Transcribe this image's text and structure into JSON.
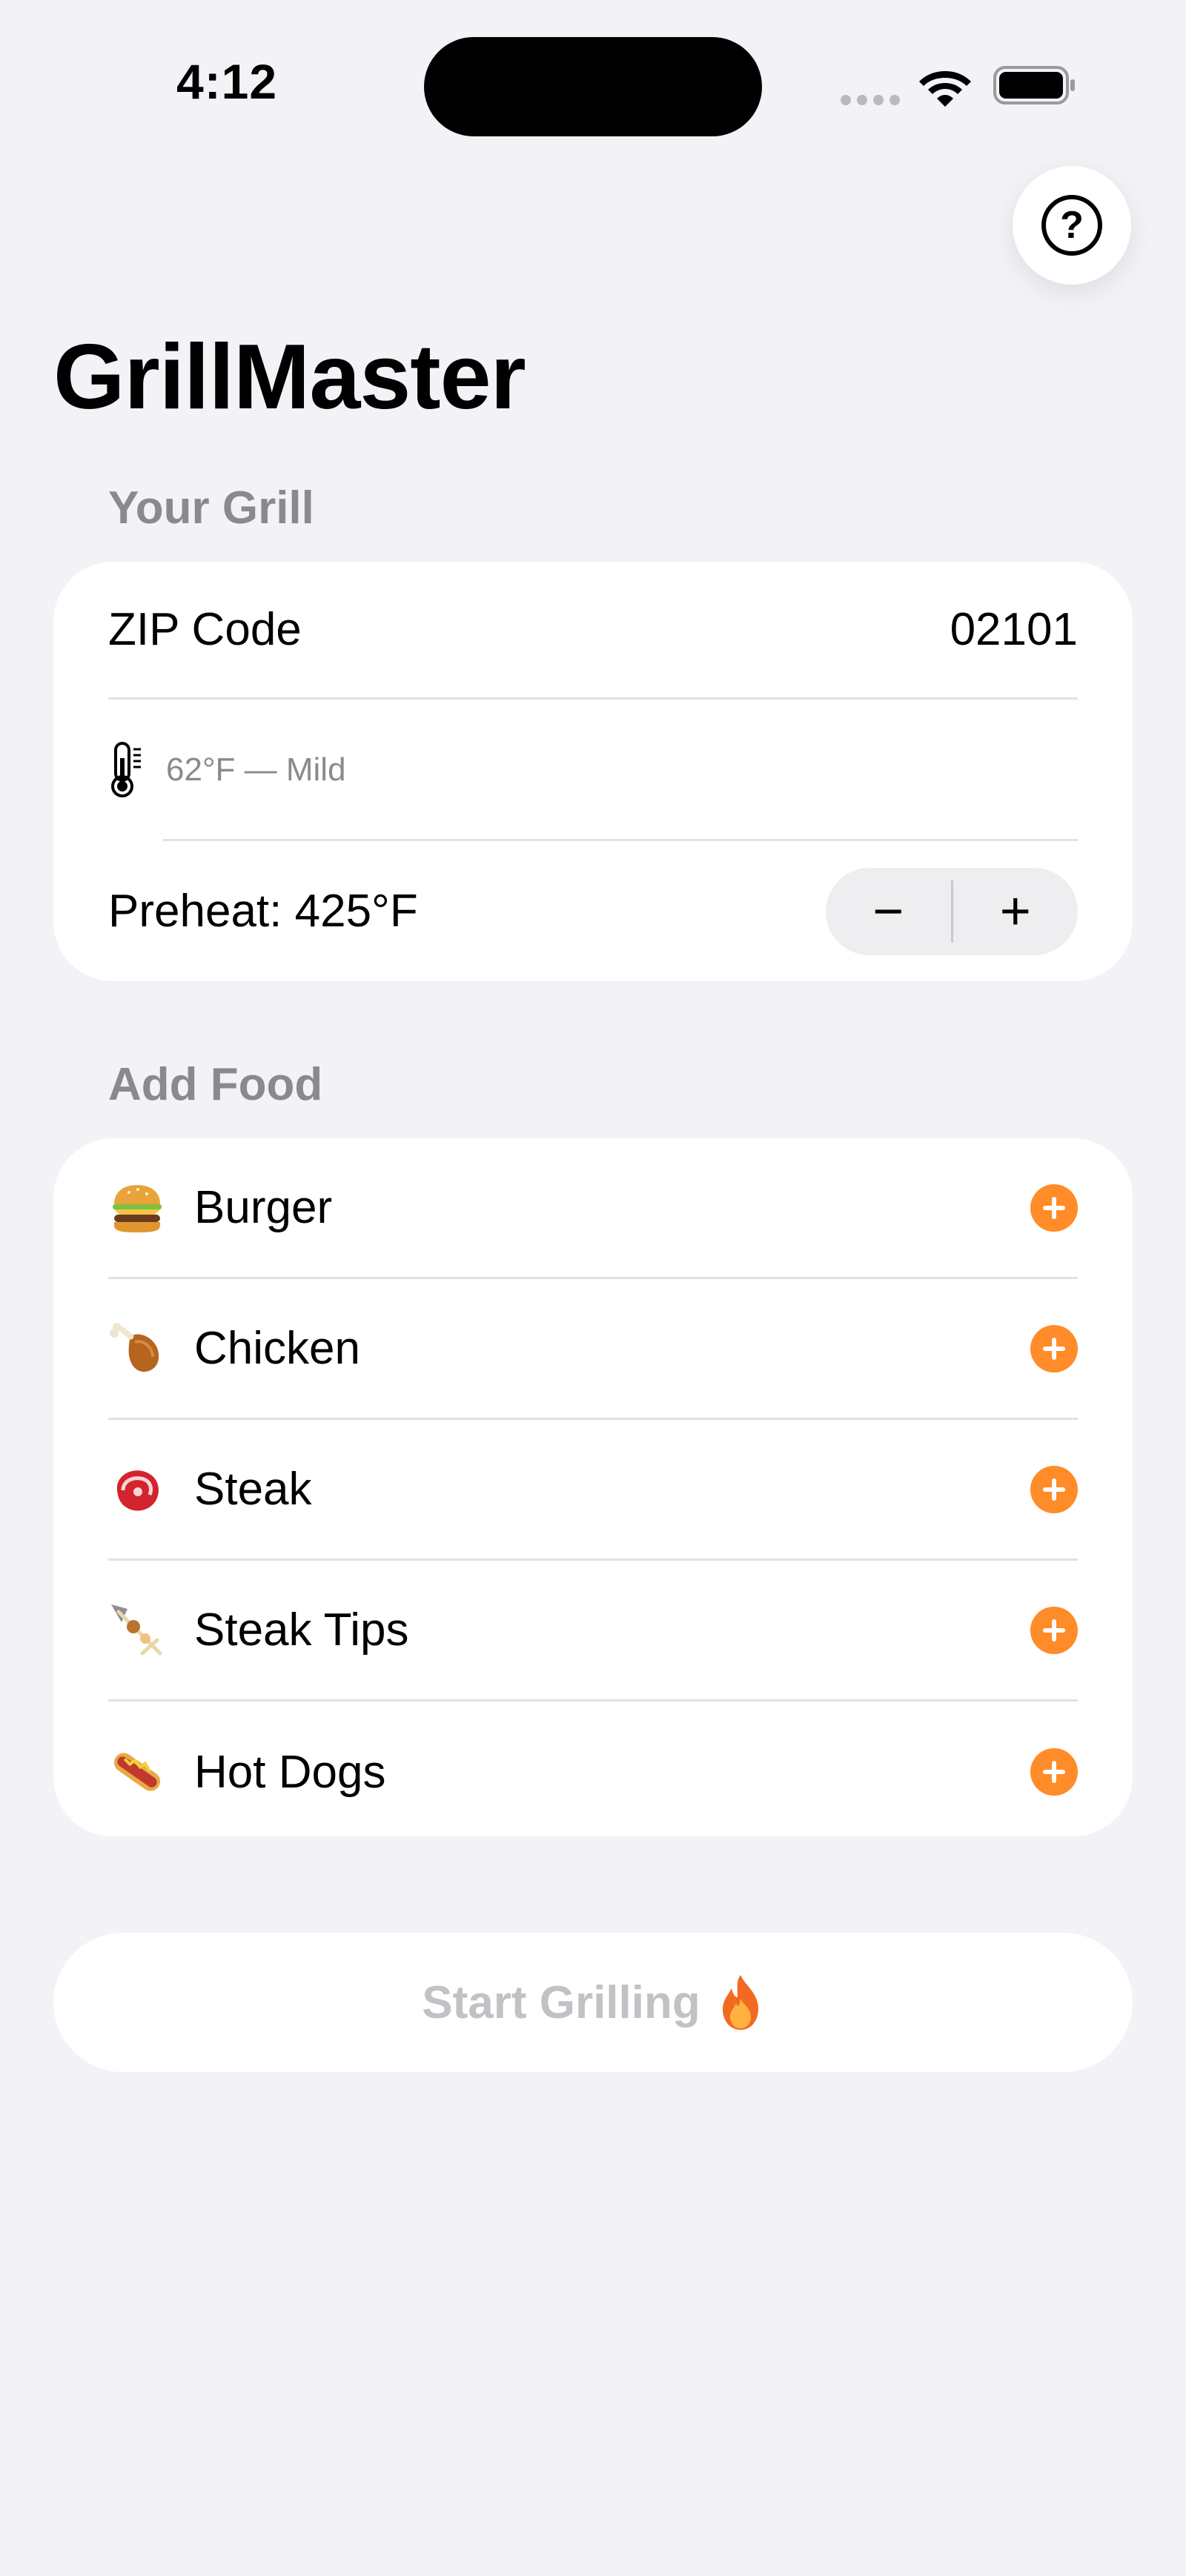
{
  "status_bar": {
    "time": "4:12"
  },
  "app": {
    "title": "GrillMaster",
    "help_icon": "question-circle-icon",
    "accent_color": "#FF8C28"
  },
  "grill_section": {
    "header": "Your Grill",
    "zip_label": "ZIP Code",
    "zip_value": "02101",
    "weather_icon": "thermometer-icon",
    "weather_text": "62°F — Mild",
    "preheat_label": "Preheat: 425°F",
    "stepper_minus": "−",
    "stepper_plus": "+"
  },
  "food_section": {
    "header": "Add Food",
    "items": [
      {
        "label": "Burger",
        "icon": "burger-icon"
      },
      {
        "label": "Chicken",
        "icon": "chicken-leg-icon"
      },
      {
        "label": "Steak",
        "icon": "steak-icon"
      },
      {
        "label": "Steak Tips",
        "icon": "skewer-icon"
      },
      {
        "label": "Hot Dogs",
        "icon": "hot-dog-icon"
      }
    ]
  },
  "start_button": {
    "label": "Start Grilling",
    "icon": "flame-icon"
  }
}
